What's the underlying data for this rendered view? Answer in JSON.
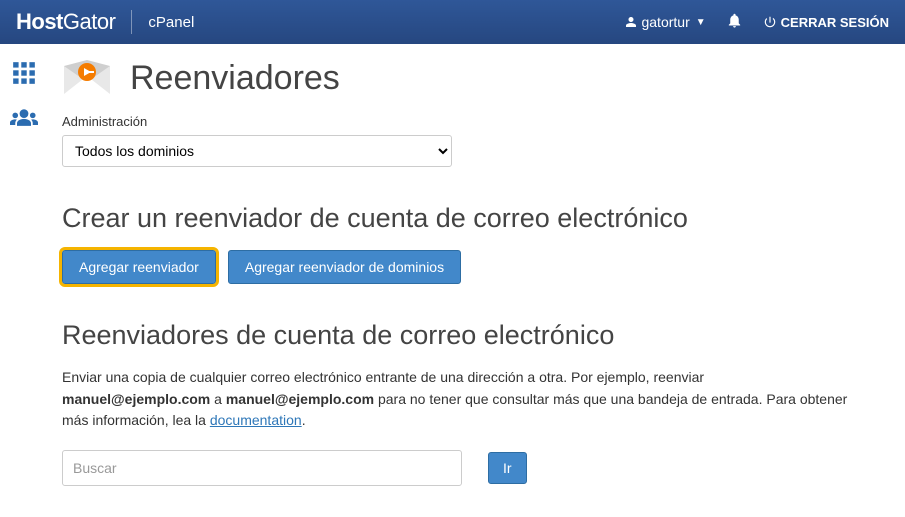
{
  "topbar": {
    "logo_a": "Host",
    "logo_b": "Gator",
    "subtitle": "cPanel",
    "username": "gatortur",
    "logout_label": "CERRAR SESIÓN"
  },
  "sidebar": {
    "items": [
      {
        "name": "apps"
      },
      {
        "name": "users"
      }
    ]
  },
  "page": {
    "title": "Reenviadores"
  },
  "admin": {
    "label": "Administración",
    "selected": "Todos los dominios"
  },
  "section_create": {
    "heading": "Crear un reenviador de cuenta de correo electrónico",
    "btn_add": "Agregar reenviador",
    "btn_add_domain": "Agregar reenviador de dominios"
  },
  "section_list": {
    "heading": "Reenviadores de cuenta de correo electrónico",
    "desc_1": "Enviar una copia de cualquier correo electrónico entrante de una dirección a otra. Por ejemplo, reenviar ",
    "example_from": "manuel@ejemplo.com",
    "desc_2": " a ",
    "example_to": "manuel@ejemplo.com",
    "desc_3": " para no tener que consultar más que una bandeja de entrada. Para obtener más información, lea la ",
    "doc_link": "documentation",
    "desc_4": "."
  },
  "search": {
    "placeholder": "Buscar",
    "go": "Ir"
  }
}
